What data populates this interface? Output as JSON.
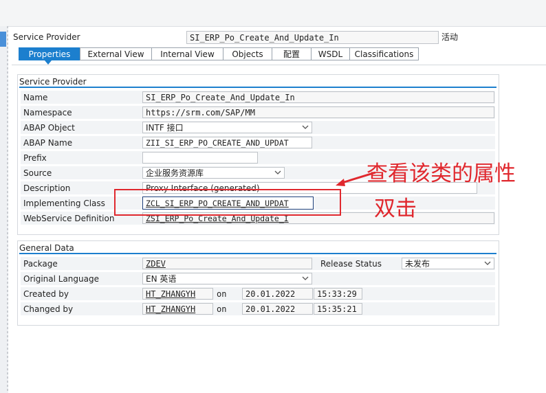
{
  "header": {
    "label": "Service Provider",
    "object_name": "SI_ERP_Po_Create_And_Update_In",
    "status": "活动"
  },
  "tabs": [
    {
      "label": "Properties",
      "active": true
    },
    {
      "label": "External View"
    },
    {
      "label": "Internal View"
    },
    {
      "label": "Objects"
    },
    {
      "label": "配置"
    },
    {
      "label": "WSDL"
    },
    {
      "label": "Classifications"
    }
  ],
  "service_provider_group": {
    "title": "Service Provider",
    "fields": {
      "name": {
        "label": "Name",
        "value": "SI_ERP_Po_Create_And_Update_In"
      },
      "namespace": {
        "label": "Namespace",
        "value": "https://srm.com/SAP/MM"
      },
      "abap_object": {
        "label": "ABAP Object",
        "value": "INTF 接口"
      },
      "abap_name": {
        "label": "ABAP Name",
        "value": "ZII_SI_ERP_PO_CREATE_AND_UPDAT"
      },
      "prefix": {
        "label": "Prefix",
        "value": ""
      },
      "source": {
        "label": "Source",
        "value": "企业服务资源库"
      },
      "description": {
        "label": "Description",
        "value": "Proxy Interface (generated)"
      },
      "implementing_class": {
        "label": "Implementing Class",
        "value": "ZCL_SI_ERP_PO_CREATE_AND_UPDAT"
      },
      "webservice_definition": {
        "label": "WebService Definition",
        "value": "ZSI_ERP_Po_Create_And_Update_I"
      }
    }
  },
  "general_data_group": {
    "title": "General Data",
    "package": {
      "label": "Package",
      "value": "ZDEV"
    },
    "release_status": {
      "label": "Release Status",
      "value": "未发布"
    },
    "original_language": {
      "label": "Original Language",
      "value": "EN 英语"
    },
    "created": {
      "label": "Created by",
      "user": "HT_ZHANGYH",
      "on": "on",
      "date": "20.01.2022",
      "time": "15:33:29"
    },
    "changed": {
      "label": "Changed by",
      "user": "HT_ZHANGYH",
      "on": "on",
      "date": "20.01.2022",
      "time": "15:35:21"
    }
  },
  "annotation": {
    "line1": "查看该类的属性",
    "line2": "双击",
    "color": "#e0282e"
  },
  "colors": {
    "accent": "#1c7fce",
    "annotation": "#e0282e"
  }
}
